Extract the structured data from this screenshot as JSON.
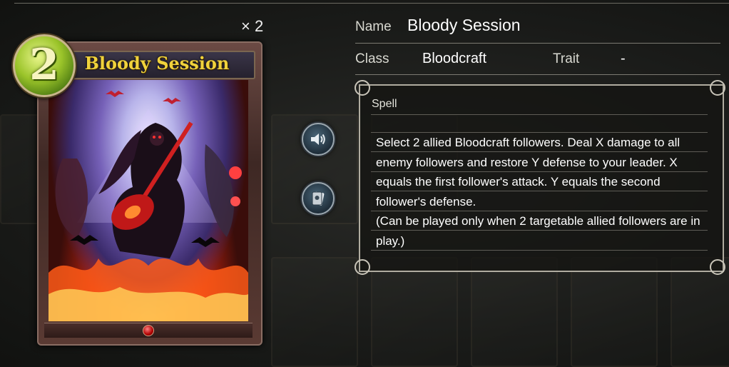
{
  "card": {
    "cost": "2",
    "name": "Bloody Session",
    "count": "× 2"
  },
  "details": {
    "name_label": "Name",
    "name_value": "Bloody Session",
    "class_label": "Class",
    "class_value": "Bloodcraft",
    "trait_label": "Trait",
    "trait_value": "-",
    "type": "Spell",
    "description": "Select 2 allied Bloodcraft followers. Deal X damage to all enemy followers and restore Y defense to your leader. X equals the first follower's attack. Y equals the second follower's defense.\n(Can be played only when 2 targetable allied followers are in play.)"
  },
  "buttons": {
    "voice_icon": "speaker-icon",
    "card_icon": "card-view-icon"
  },
  "colors": {
    "title_gold": "#f0d23c",
    "cost_green": "#9bc42a"
  }
}
